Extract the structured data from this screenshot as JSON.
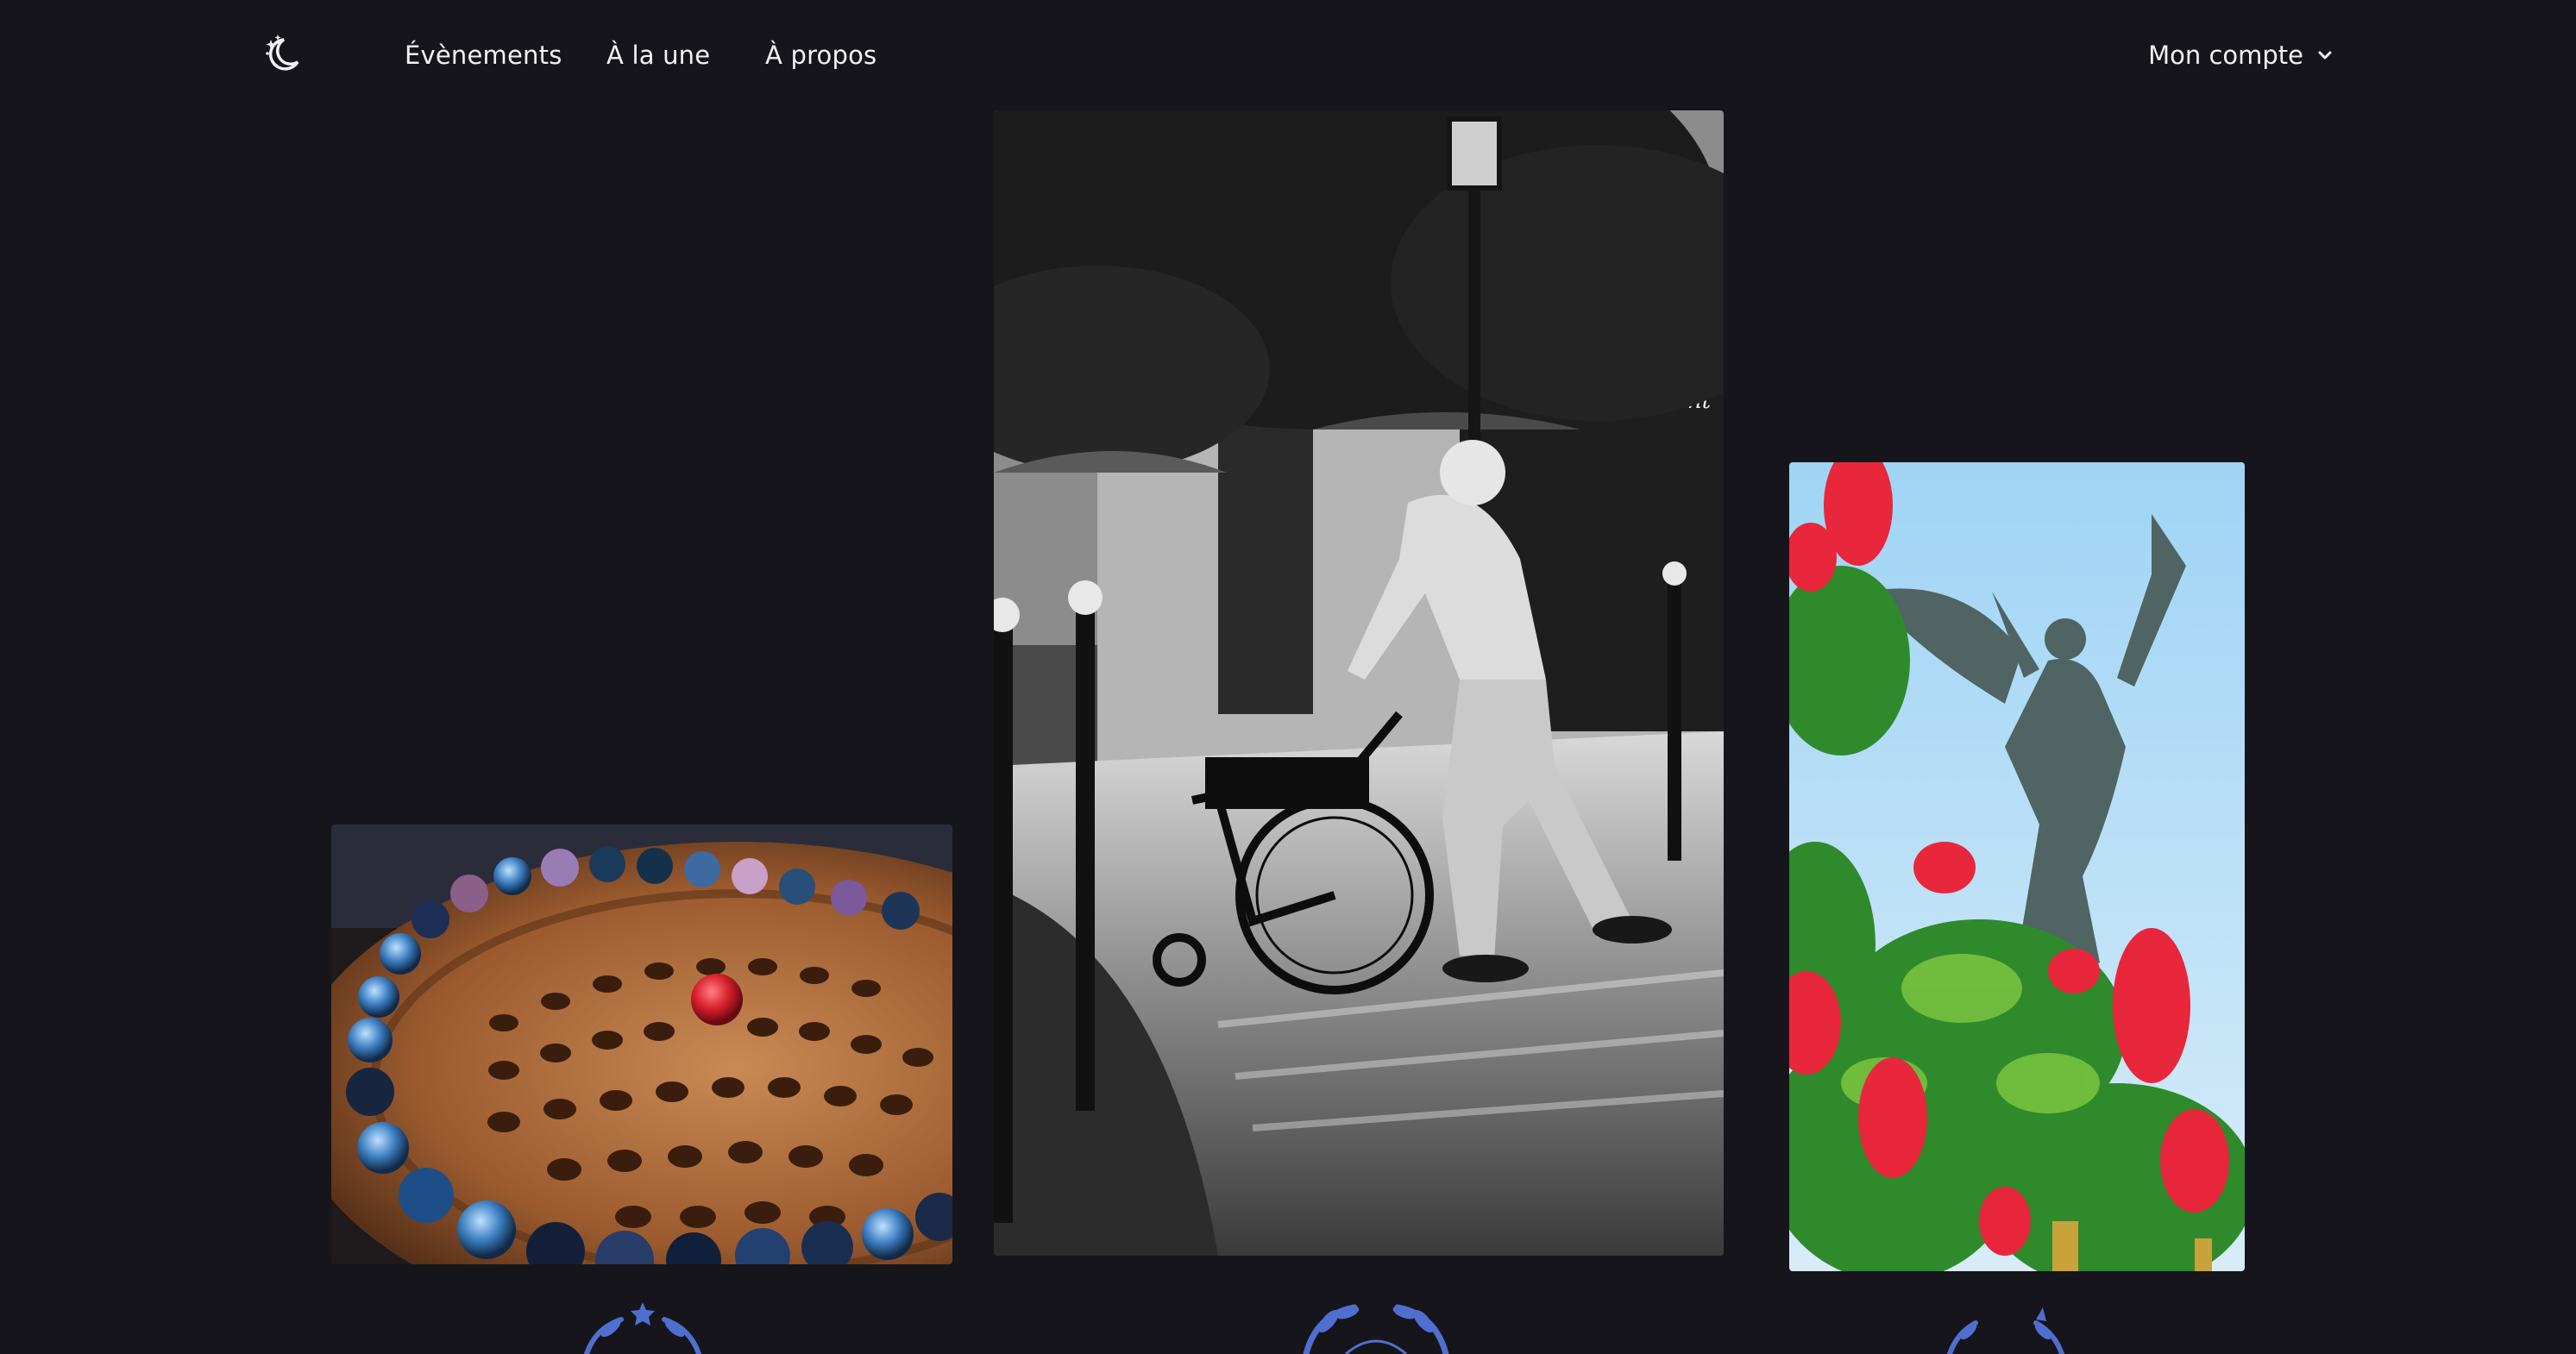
{
  "navbar": {
    "logo_icon": "moon-stars-icon",
    "links": [
      {
        "label": "Évènements"
      },
      {
        "label": "À la une"
      },
      {
        "label": "À propos"
      }
    ],
    "account": {
      "label": "Mon compte",
      "icon": "chevron-down-icon"
    }
  },
  "gallery": {
    "photos": [
      {
        "subject": "wooden solitaire board with blue marbles and a red marble"
      },
      {
        "subject": "black and white street photo of an elderly man with a wheelchair"
      },
      {
        "subject": "winged bronze statue behind red flowers against blue sky"
      }
    ]
  },
  "emblems": {
    "icons": [
      "laurel-emblem-icon",
      "laurel-emblem-icon",
      "laurel-emblem-icon"
    ]
  },
  "colors": {
    "background": "#16151b",
    "text": "#f2f2f4",
    "emblem": "#4f6fd0"
  }
}
